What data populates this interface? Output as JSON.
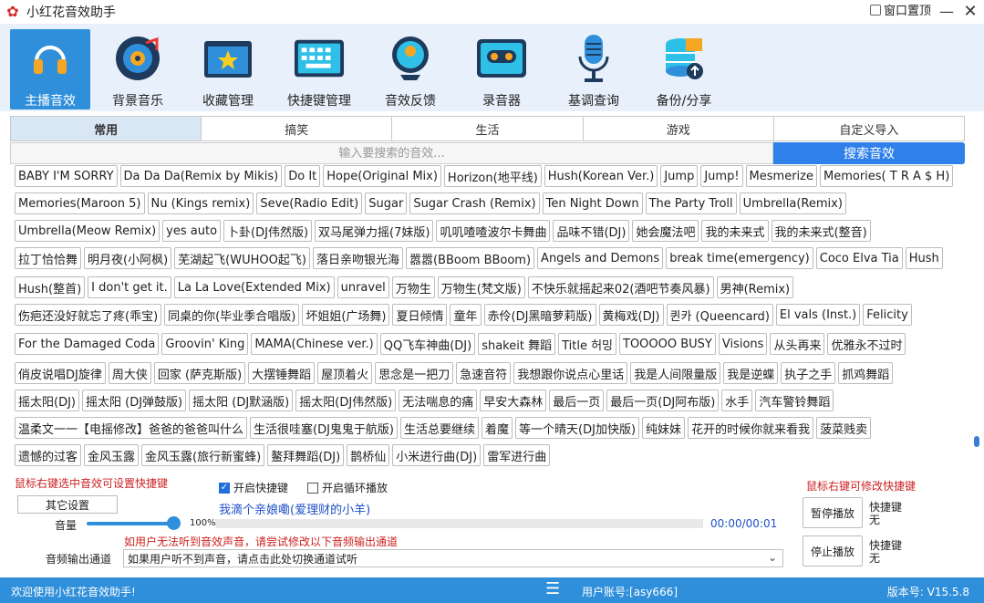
{
  "window": {
    "title": "小红花音效助手",
    "pin_label": "窗口置顶",
    "minimize_glyph": "—",
    "close_glyph": "✕"
  },
  "toolbar": [
    {
      "label": "主播音效",
      "icon": "headphones-icon",
      "active": true
    },
    {
      "label": "背景音乐",
      "icon": "music-disc-icon",
      "active": false
    },
    {
      "label": "收藏管理",
      "icon": "folder-star-icon",
      "active": false
    },
    {
      "label": "快捷键管理",
      "icon": "keyboard-icon",
      "active": false
    },
    {
      "label": "音效反馈",
      "icon": "feedback-icon",
      "active": false
    },
    {
      "label": "录音器",
      "icon": "cassette-icon",
      "active": false
    },
    {
      "label": "基调查询",
      "icon": "microphone-icon",
      "active": false
    },
    {
      "label": "备份/分享",
      "icon": "database-upload-icon",
      "active": false
    }
  ],
  "tabs": [
    "常用",
    "搞笑",
    "生活",
    "游戏",
    "自定义导入"
  ],
  "active_tab": "常用",
  "search": {
    "placeholder": "输入要搜索的音效...",
    "button": "搜索音效"
  },
  "sound_rows": [
    [
      "BABY I'M SORRY",
      "Da Da Da(Remix by Mikis)",
      "Do It",
      "Hope(Original Mix)",
      "Horizon(地平线)",
      "Hush(Korean Ver.)",
      "Jump",
      "Jump!",
      "Mesmerize",
      "Memories( T R A $ H)"
    ],
    [
      "Memories(Maroon 5)",
      "Nu (Kings remix)",
      "Seve(Radio Edit)",
      "Sugar",
      "Sugar Crash (Remix)",
      "Ten Night Down",
      "The Party Troll",
      "Umbrella(Remix)"
    ],
    [
      "Umbrella(Meow Remix)",
      "yes auto",
      "卜卦(DJ伟然版)",
      "双马尾弹力摇(7妹版)",
      "叽叽喳喳波尔卡舞曲",
      "品味不错(DJ)",
      "她会魔法吧",
      "我的未来式",
      "我的未来式(整音)"
    ],
    [
      "拉丁恰恰舞",
      "明月夜(小阿枫)",
      "芜湖起飞(WUHOO起飞)",
      "落日亲吻银光海",
      "嚣嚣(BBoom BBoom)",
      "Angels and Demons",
      "break time(emergency)",
      "Coco Elva Tia",
      "Hush"
    ],
    [
      "Hush(整首)",
      "I don't get it.",
      "La La Love(Extended Mix)",
      "unravel",
      "万物生",
      "万物生(梵文版)",
      "不快乐就摇起来02(酒吧节奏风暴)",
      "男神(Remix)"
    ],
    [
      "伤疤还没好就忘了疼(乖宝)",
      "同桌的你(毕业季合唱版)",
      "坏姐姐(广场舞)",
      "夏日倾情",
      "童年",
      "赤伶(DJ黑暗萝莉版)",
      "黄梅戏(DJ)",
      "퀸카 (Queencard)",
      "El vals (Inst.)",
      "Felicity"
    ],
    [
      "For the Damaged Coda",
      "Groovin' King",
      "MAMA(Chinese ver.)",
      "QQ飞车神曲(DJ)",
      "shakeit 舞蹈",
      "Title 허밍",
      "TOOOOO BUSY",
      "Visions",
      "从头再来",
      "优雅永不过时"
    ],
    [
      "俏皮说唱DJ旋律",
      "周大侠",
      "回家 (萨克斯版)",
      "大摆锤舞蹈",
      "屋顶着火",
      "思念是一把刀",
      "急速音符",
      "我想跟你说点心里话",
      "我是人间限量版",
      "我是逆蝶",
      "执子之手",
      "抓鸡舞蹈"
    ],
    [
      "摇太阳(DJ)",
      "摇太阳 (DJ弹鼓版)",
      "摇太阳 (DJ默涵版)",
      "摇太阳(DJ伟然版)",
      "无法喘息的痛",
      "早安大森林",
      "最后一页",
      "最后一页(DJ阿布版)",
      "水手",
      "汽车警铃舞蹈"
    ],
    [
      "温柔文一一【电摇修改】爸爸的爸爸叫什么",
      "生活很哇塞(DJ鬼鬼于航版)",
      "生活总要继续",
      "着魔",
      "等一个晴天(DJ加快版)",
      "纯妹妹",
      "花开的时候你就来看我",
      "菠菜贱卖"
    ],
    [
      "遗憾的过客",
      "金风玉露",
      "金风玉露(旅行新蜜蜂)",
      "鳌拜舞蹈(DJ)",
      "鹊桥仙",
      "小米进行曲(DJ)",
      "雷军进行曲"
    ]
  ],
  "bottom": {
    "hint_left": "鼠标右键选中音效可设置快捷键",
    "hint_right": "鼠标右键可修改快捷键",
    "enable_hotkey": "开启快捷键",
    "enable_hotkey_checked": true,
    "loop_play": "开启循环播放",
    "loop_play_checked": false,
    "other_settings": "其它设置",
    "now_playing": "我滴个亲娘嘞(爱理财的小羊)",
    "volume_label": "音量",
    "volume_value": "100%",
    "volume_level": 1.0,
    "progress_level": 0.0,
    "time": "00:00/00:01",
    "audio_hint": "如用户无法听到音效声音，请尝试修改以下音频输出通道",
    "audio_label": "音频输出通道",
    "audio_value": "如果用户听不到声音，请点击此处切换通道试听",
    "pause_button": "暂停播放",
    "stop_button": "停止播放",
    "hotkey_title": "快捷键",
    "hotkey_none": "无"
  },
  "status": {
    "welcome": "欢迎使用小红花音效助手!",
    "account": "用户账号:[asy666]",
    "version": "版本号: V15.5.8",
    "menu_glyph": "☰"
  },
  "colors": {
    "accent": "#2f8fda",
    "search_button": "#2f80e8",
    "hint_red": "#cc2222",
    "toolbar_bg": "#e8f1fb"
  }
}
